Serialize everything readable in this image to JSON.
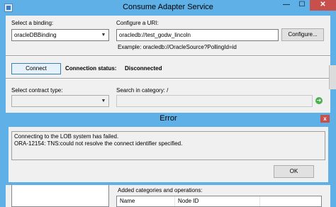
{
  "main_window": {
    "title": "Consume Adapter Service",
    "controls": {
      "minimize": "—",
      "maximize": "☐",
      "close": "✕"
    }
  },
  "binding": {
    "label": "Select a binding:",
    "selected": "oracleDBBinding"
  },
  "uri": {
    "label": "Configure a URI:",
    "value": "oracledb://test_godw_lincoln",
    "configure_button": "Configure...",
    "example": "Example: oracledb://OracleSource?PollingId=id"
  },
  "connection": {
    "connect_button": "Connect",
    "status_label": "Connection status:",
    "status_value": "Disconnected"
  },
  "contract": {
    "label": "Select contract type:",
    "selected": ""
  },
  "search": {
    "label": "Search in category: /",
    "value": ""
  },
  "operations": {
    "label": "Added categories and operations:",
    "columns": [
      "Name",
      "Node ID"
    ]
  },
  "error_dialog": {
    "title": "Error",
    "close": "x",
    "messages": [
      "Connecting to the LOB system has failed.",
      "ORA-12154: TNS:could not resolve the connect identifier specified."
    ],
    "ok_button": "OK"
  }
}
